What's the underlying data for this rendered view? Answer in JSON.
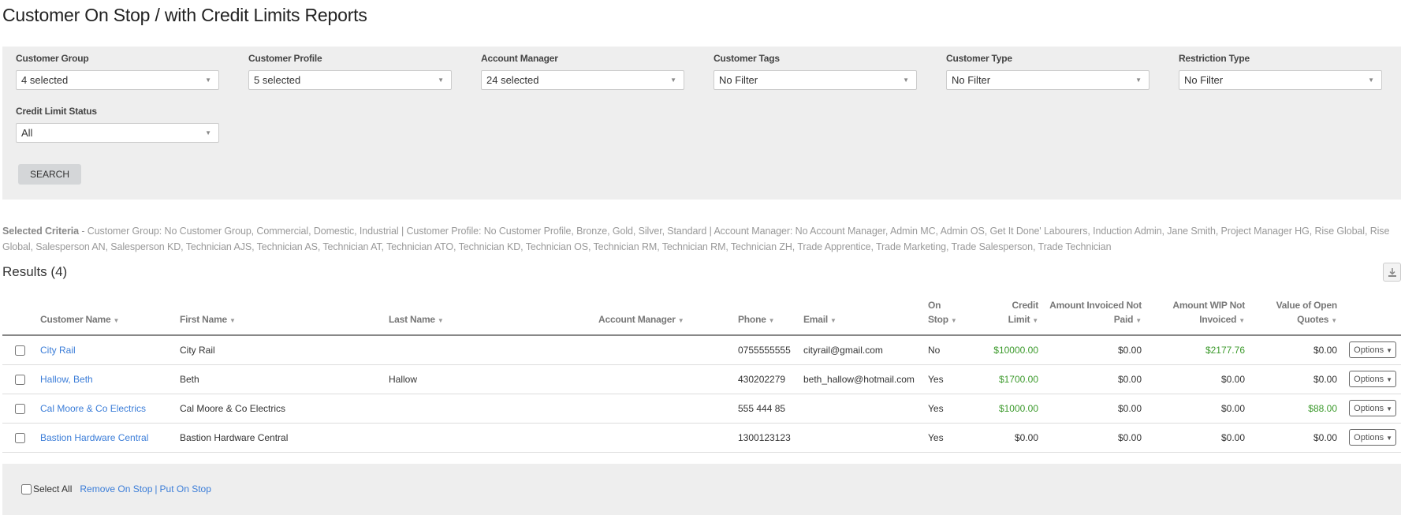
{
  "page": {
    "title": "Customer On Stop / with Credit Limits Reports"
  },
  "filters": {
    "customer_group": {
      "label": "Customer Group",
      "value": "4 selected"
    },
    "customer_profile": {
      "label": "Customer Profile",
      "value": "5 selected"
    },
    "account_manager": {
      "label": "Account Manager",
      "value": "24 selected"
    },
    "customer_tags": {
      "label": "Customer Tags",
      "value": "No Filter"
    },
    "customer_type": {
      "label": "Customer Type",
      "value": "No Filter"
    },
    "restriction_type": {
      "label": "Restriction Type",
      "value": "No Filter"
    },
    "credit_limit_status": {
      "label": "Credit Limit Status",
      "value": "All"
    },
    "search_label": "SEARCH",
    "caret_icon": "▼"
  },
  "criteria": {
    "label": "Selected Criteria",
    "text": " - Customer Group: No Customer Group, Commercial, Domestic, Industrial | Customer Profile: No Customer Profile, Bronze, Gold, Silver, Standard | Account Manager: No Account Manager, Admin MC, Admin OS, Get It Done' Labourers, Induction Admin, Jane Smith, Project Manager HG, Rise Global, Rise Global, Salesperson AN, Salesperson KD, Technician AJS, Technician AS, Technician AT, Technician ATO, Technician KD, Technician OS, Technician RM, Technician RM, Technician ZH, Trade Apprentice, Trade Marketing, Trade Salesperson, Trade Technician"
  },
  "results": {
    "title": "Results (4)",
    "download_icon": "download-icon",
    "columns": {
      "customer_name": "Customer Name",
      "first_name": "First Name",
      "last_name": "Last Name",
      "account_manager": "Account Manager",
      "phone": "Phone",
      "email": "Email",
      "on_stop_1": "On",
      "on_stop_2": "Stop",
      "credit_limit_1": "Credit",
      "credit_limit_2": "Limit",
      "invoiced_1": "Amount Invoiced Not",
      "invoiced_2": "Paid",
      "wip_1": "Amount WIP Not",
      "wip_2": "Invoiced",
      "quotes_1": "Value of Open",
      "quotes_2": "Quotes"
    },
    "sort_icon": "▼",
    "rows": [
      {
        "customer_name": "City Rail",
        "first_name": "City Rail",
        "last_name": "",
        "account_manager": "",
        "phone": "0755555555",
        "email": "cityrail@gmail.com",
        "on_stop": "No",
        "credit_limit": "$10000.00",
        "invoiced_not_paid": "$0.00",
        "wip_not_invoiced": "$2177.76",
        "open_quotes": "$0.00",
        "options": "Options"
      },
      {
        "customer_name": "Hallow, Beth",
        "first_name": "Beth",
        "last_name": "Hallow",
        "account_manager": "",
        "phone": "430202279",
        "email": "beth_hallow@hotmail.com",
        "on_stop": "Yes",
        "credit_limit": "$1700.00",
        "invoiced_not_paid": "$0.00",
        "wip_not_invoiced": "$0.00",
        "open_quotes": "$0.00",
        "options": "Options"
      },
      {
        "customer_name": "Cal Moore & Co Electrics",
        "first_name": "Cal Moore & Co Electrics",
        "last_name": "",
        "account_manager": "",
        "phone": "555 444 85",
        "email": "",
        "on_stop": "Yes",
        "credit_limit": "$1000.00",
        "invoiced_not_paid": "$0.00",
        "wip_not_invoiced": "$0.00",
        "open_quotes": "$88.00",
        "options": "Options"
      },
      {
        "customer_name": "Bastion Hardware Central",
        "first_name": "Bastion Hardware Central",
        "last_name": "",
        "account_manager": "",
        "phone": "1300123123",
        "email": "",
        "on_stop": "Yes",
        "credit_limit": "$0.00",
        "invoiced_not_paid": "$0.00",
        "wip_not_invoiced": "$0.00",
        "open_quotes": "$0.00",
        "options": "Options"
      }
    ]
  },
  "footer": {
    "select_all": "Select All",
    "remove_on_stop": "Remove On Stop",
    "separator": "|",
    "put_on_stop": "Put On Stop"
  },
  "colors": {
    "link": "#3b7dd8",
    "positive_amount": "#3c9a2c",
    "panel_background": "#eeeeee"
  }
}
